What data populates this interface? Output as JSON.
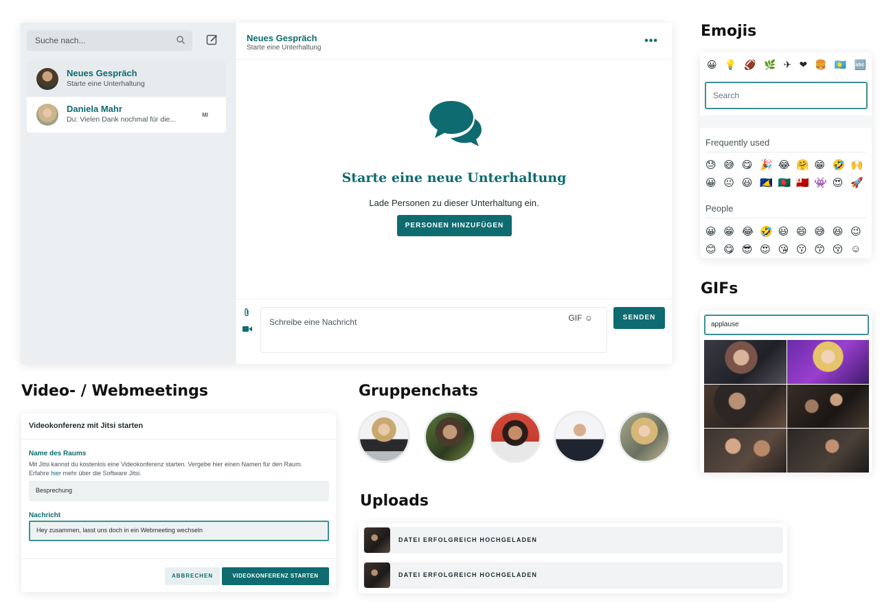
{
  "sidebar": {
    "search_placeholder": "Suche nach...",
    "conversations": [
      {
        "name": "Neues Gespräch",
        "preview": "Starte eine Unterhaltung",
        "tag": ""
      },
      {
        "name": "Daniela Mahr",
        "preview": "Du: Vielen Dank nochmal für die...",
        "tag": "MI"
      }
    ]
  },
  "chat": {
    "header_title": "Neues Gespräch",
    "header_subtitle": "Starte eine Unterhaltung",
    "more": "•••",
    "empty_title": "Starte eine neue Unterhaltung",
    "empty_text": "Lade Personen zu dieser Unterhaltung ein.",
    "add_people": "PERSONEN HINZUFÜGEN",
    "message_placeholder": "Schreibe eine Nachricht",
    "gif_label": "GIF ☺",
    "send": "SENDEN"
  },
  "headings": {
    "emojis": "Emojis",
    "gifs": "GIFs",
    "video": "Video- / Webmeetings",
    "groups": "Gruppenchats",
    "uploads": "Uploads"
  },
  "emoji_panel": {
    "categories": [
      "😀",
      "💡",
      "🏈",
      "🌿",
      "✈",
      "❤",
      "🍔",
      "🇵🇼",
      "🔤"
    ],
    "search_placeholder": "Search",
    "frequent_label": "Frequently used",
    "frequent": [
      "😓",
      "😅",
      "😋",
      "🎉",
      "😂",
      "🤗",
      "😁",
      "🤣",
      "🙌",
      "😀",
      "😐",
      "😃",
      "🇹🇰",
      "🇧🇩",
      "🇹🇴",
      "👾",
      "😍",
      "🚀"
    ],
    "people_label": "People",
    "people": [
      "😀",
      "😁",
      "😂",
      "🤣",
      "😃",
      "😄",
      "😅",
      "😆",
      "😉",
      "😊",
      "😋",
      "😎",
      "😍",
      "😘",
      "😗",
      "😙",
      "😚",
      "☺"
    ]
  },
  "gif_panel": {
    "search_value": "applause"
  },
  "video_dialog": {
    "title": "Videokonferenz mit Jitsi starten",
    "room_label": "Name des Raums",
    "description_a": "Mit Jitsi kannst du kostenlos eine Videokonferenz starten. Vergebe hier einen Namen für den Raum. Erfahre ",
    "description_link": "hier",
    "description_b": " mehr über die Software Jitsi.",
    "room_value": "Besprechung",
    "message_label": "Nachricht",
    "message_value": "Hey zusammen, lasst uns doch in ein Webmeeting wechseln",
    "cancel": "ABBRECHEN",
    "start": "VIDEOKONFERENZ STARTEN"
  },
  "uploads": [
    {
      "status": "DATEI ERFOLGREICH HOCHGELADEN"
    },
    {
      "status": "DATEI ERFOLGREICH HOCHGELADEN"
    }
  ],
  "colors": {
    "accent": "#0e6b70",
    "sidebar": "#eceff1"
  }
}
